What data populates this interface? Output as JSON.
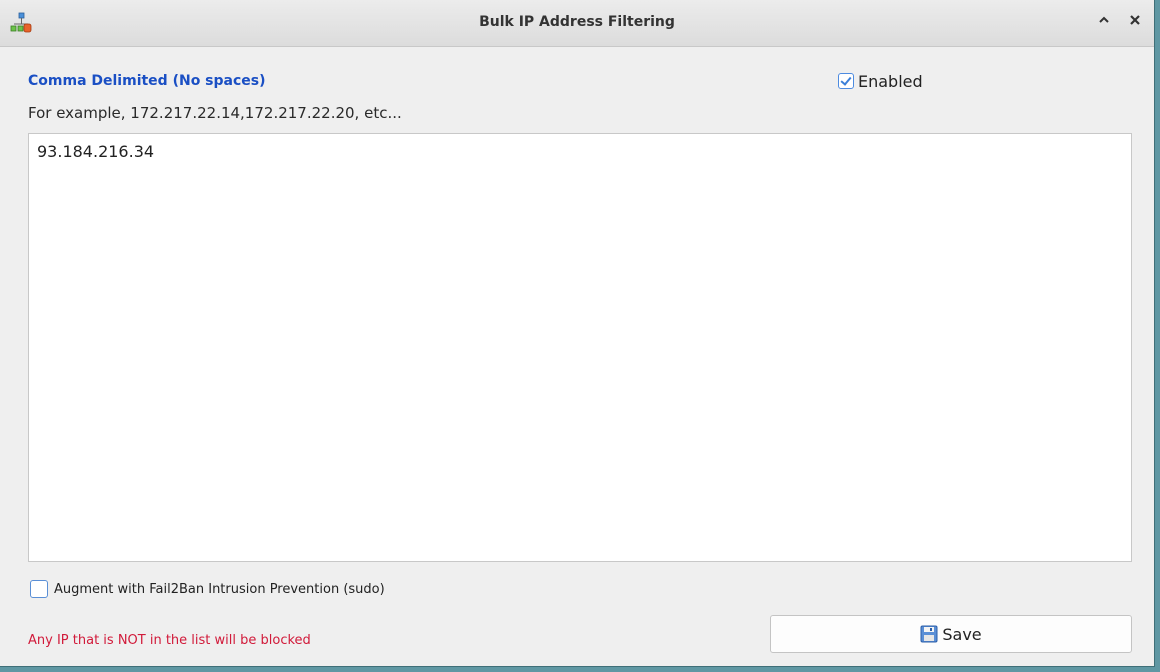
{
  "window": {
    "title": "Bulk IP Address Filtering",
    "app_icon": "network-nodes-icon",
    "buttons": {
      "collapse_icon": "chevron-up-icon",
      "close_icon": "close-icon"
    }
  },
  "form": {
    "heading": "Comma Delimited (No spaces)",
    "example": "For example, 172.217.22.14,172.217.22.20, etc...",
    "enabled_label": "Enabled",
    "enabled_checked": true,
    "ip_list_value": "93.184.216.34",
    "augment_label": "Augment with Fail2Ban Intrusion Prevention (sudo)",
    "augment_checked": false,
    "warning": "Any IP that is NOT in the list will be blocked",
    "save_label": "Save",
    "save_icon": "save-disk-icon"
  },
  "colors": {
    "heading": "#1a4fc4",
    "warning": "#d11a3a",
    "desktop": "#5f97a3"
  }
}
